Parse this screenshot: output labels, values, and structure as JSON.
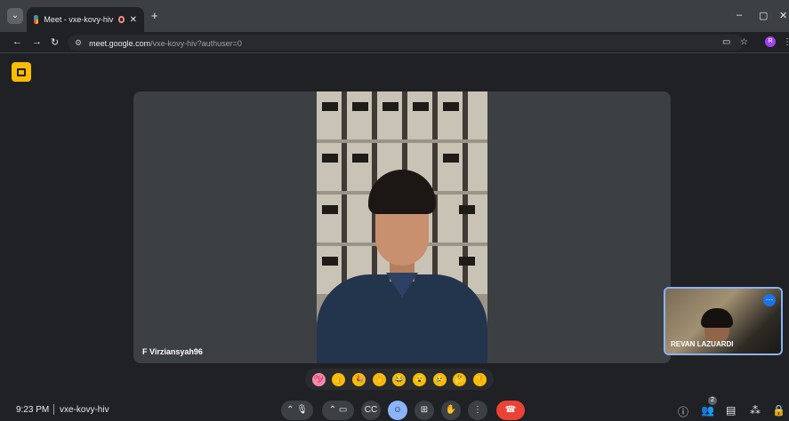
{
  "browser": {
    "tab_title": "Meet - vxe-kovy-hiv",
    "url_host": "meet.google.com",
    "url_path": "/vxe-kovy-hiv?authuser=0",
    "profile_initial": "R"
  },
  "meeting": {
    "main_participant_name": "F Virziansyah96",
    "self_participant_name": "REVAN LAZUARDI",
    "time": "9:23 PM",
    "code": "vxe-kovy-hiv",
    "participant_count": "2"
  },
  "reactions": [
    {
      "emoji": "💖",
      "name": "sparkling-heart"
    },
    {
      "emoji": "👍",
      "name": "thumbs-up"
    },
    {
      "emoji": "🎉",
      "name": "party-popper"
    },
    {
      "emoji": "👏",
      "name": "clapping-hands"
    },
    {
      "emoji": "😂",
      "name": "tears-of-joy"
    },
    {
      "emoji": "😮",
      "name": "surprised-face"
    },
    {
      "emoji": "😢",
      "name": "crying-face"
    },
    {
      "emoji": "🤔",
      "name": "thinking-face"
    },
    {
      "emoji": "👎",
      "name": "thumbs-down"
    }
  ],
  "colors": {
    "accent": "#8ab4f8",
    "hangup": "#ea4335",
    "info_chip": "#fbbc04",
    "background": "#202124"
  }
}
